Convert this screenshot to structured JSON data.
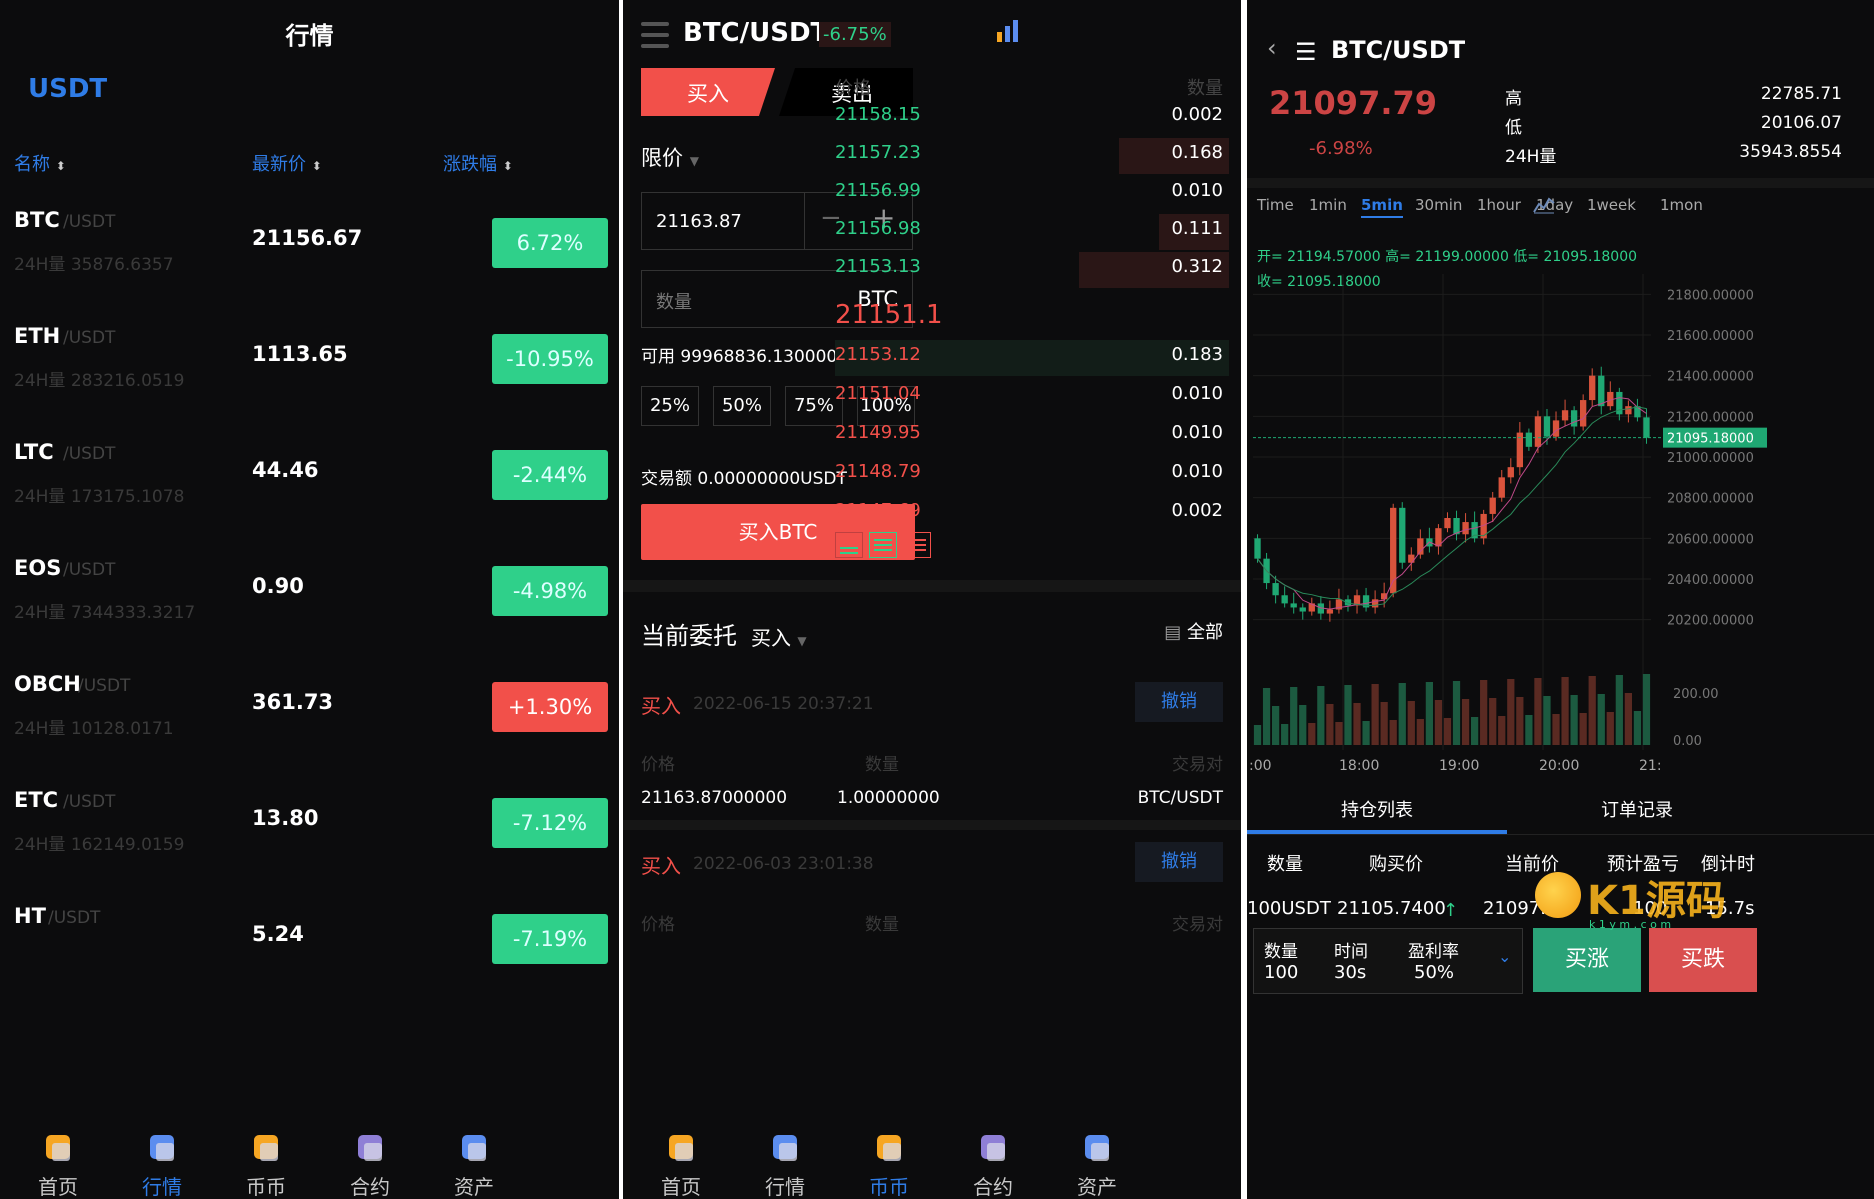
{
  "market": {
    "title": "行情",
    "quote": "USDT",
    "col_name": "名称",
    "col_price": "最新价",
    "col_change": "涨跌幅",
    "rows": [
      {
        "sym": "BTC",
        "pair": "/USDT",
        "vol": "24H量 35876.6357",
        "price": "21156.67",
        "chg": "6.72%",
        "up": true
      },
      {
        "sym": "ETH",
        "pair": "/USDT",
        "vol": "24H量 283216.0519",
        "price": "1113.65",
        "chg": "-10.95%",
        "up": true
      },
      {
        "sym": "LTC",
        "pair": "/USDT",
        "vol": "24H量 173175.1078",
        "price": "44.46",
        "chg": "-2.44%",
        "up": true
      },
      {
        "sym": "EOS",
        "pair": "/USDT",
        "vol": "24H量 7344333.3217",
        "price": "0.90",
        "chg": "-4.98%",
        "up": true
      },
      {
        "sym": "OBCH",
        "pair": "/USDT",
        "vol": "24H量 10128.0171",
        "price": "361.73",
        "chg": "+1.30%",
        "up": false
      },
      {
        "sym": "ETC",
        "pair": "/USDT",
        "vol": "24H量 162149.0159",
        "price": "13.80",
        "chg": "-7.12%",
        "up": true
      },
      {
        "sym": "HT",
        "pair": "/USDT",
        "vol": "",
        "price": "5.24",
        "chg": "-7.19%",
        "up": true
      }
    ]
  },
  "tabs": [
    "首页",
    "行情",
    "币币",
    "合约",
    "资产"
  ],
  "trade": {
    "pair": "BTC/USDT",
    "change": "-6.75%",
    "buy_tab": "买入",
    "sell_tab": "卖出",
    "order_type": "限价",
    "price_value": "21163.87",
    "qty_placeholder": "数量",
    "qty_unit": "BTC",
    "available": "可用 99968836.13000000 USDT",
    "pcts": [
      "25%",
      "50%",
      "75%",
      "100%"
    ],
    "amount": "交易额 0.00000000USDT",
    "buy_button": "买入BTC",
    "book_price_h": "价格",
    "book_qty_h": "数量",
    "asks": [
      [
        "21158.15",
        "0.002"
      ],
      [
        "21157.23",
        "0.168"
      ],
      [
        "21156.99",
        "0.010"
      ],
      [
        "21156.98",
        "0.111"
      ],
      [
        "21153.13",
        "0.312"
      ]
    ],
    "last": "21151.1",
    "bids": [
      [
        "21153.12",
        "0.183"
      ],
      [
        "21151.04",
        "0.010"
      ],
      [
        "21149.95",
        "0.010"
      ],
      [
        "21148.79",
        "0.010"
      ],
      [
        "21147.69",
        "0.002"
      ]
    ],
    "orders_title": "当前委托",
    "orders_filter": "买入",
    "orders_all": "全部",
    "orders": [
      {
        "side": "买入",
        "time": "2022-06-15 20:37:21",
        "cancel": "撤销",
        "h_price": "价格",
        "h_qty": "数量",
        "h_pair": "交易对",
        "price": "21163.87000000",
        "qty": "1.00000000",
        "pair": "BTC/USDT"
      },
      {
        "side": "买入",
        "time": "2022-06-03 23:01:38",
        "cancel": "撤销",
        "h_price": "价格",
        "h_qty": "数量",
        "h_pair": "交易对"
      }
    ]
  },
  "contract": {
    "pair": "BTC/USDT",
    "price": "21097.79",
    "change": "-6.98%",
    "stats": [
      [
        "高",
        "22785.71"
      ],
      [
        "低",
        "20106.07"
      ],
      [
        "24H量",
        "35943.8554"
      ]
    ],
    "intervals": [
      "Time",
      "1min",
      "5min",
      "30min",
      "1hour",
      "1day",
      "1week",
      "1mon"
    ],
    "active_interval": "5min",
    "ohlc1": "开= 21194.57000  高= 21199.00000  低= 21095.18000",
    "ohlc2": "收= 21095.18000",
    "y_ticks": [
      "21800.00000",
      "21600.00000",
      "21400.00000",
      "21200.00000",
      "21000.00000",
      "20800.00000",
      "20600.00000",
      "20400.00000",
      "20200.00000"
    ],
    "last_tag": "21095.18000",
    "vol_ticks": [
      "200.00",
      "0.00"
    ],
    "x_ticks": [
      ":00",
      "18:00",
      "19:00",
      "20:00",
      "21:"
    ],
    "pos_tab": "持仓列表",
    "order_tab": "订单记录",
    "cols": [
      "数量",
      "购买价",
      "当前价",
      "预计盈亏",
      "倒计时"
    ],
    "row": [
      "100USDT",
      "21105.7400",
      "21097.",
      "100",
      "15.7s"
    ],
    "f_qty_l": "数量",
    "f_qty_v": "100",
    "f_time_l": "时间",
    "f_time_v": "30s",
    "f_rate_l": "盈利率",
    "f_rate_v": "50%",
    "btn_up": "买涨",
    "btn_down": "买跌",
    "watermark": "K1源码",
    "watermark_sub": "k 1 y m . c o m"
  },
  "colors": {
    "up": "#2fd08a",
    "down": "#f2504a",
    "accent": "#2f7ce6",
    "bg": "#0c0c0d"
  }
}
